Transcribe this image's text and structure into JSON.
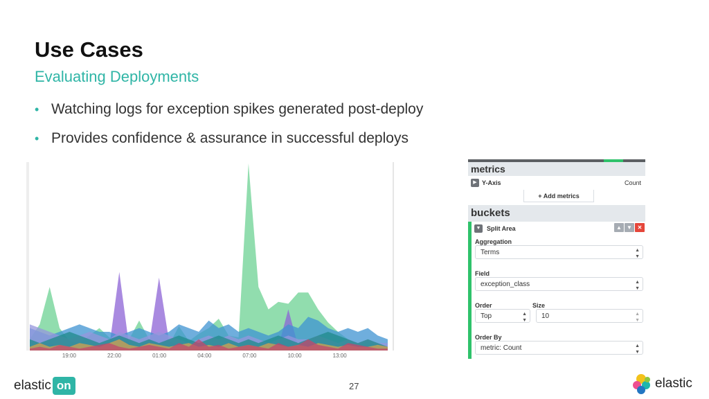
{
  "slide": {
    "title": "Use Cases",
    "subtitle": "Evaluating Deployments",
    "bullets": [
      "Watching logs for exception spikes generated post-deploy",
      "Provides confidence & assurance in successful deploys"
    ],
    "bullet_color": "#2fb5a6",
    "page_number": "27"
  },
  "chart_data": {
    "type": "area",
    "title": "",
    "xlabel": "",
    "ylabel": "",
    "stacked": false,
    "grid": false,
    "legend": "none",
    "x": [
      "19:00",
      "22:00",
      "01:00",
      "04:00",
      "07:00",
      "10:00",
      "13:00"
    ],
    "ylim": [
      0,
      100
    ],
    "series": [
      {
        "color": "#76d49a",
        "values": [
          6,
          14,
          34,
          12,
          5,
          4,
          8,
          12,
          7,
          4,
          6,
          16,
          6,
          5,
          3,
          13,
          5,
          9,
          12,
          17,
          8,
          7,
          100,
          34,
          22,
          26,
          25,
          31,
          31,
          22,
          15,
          10,
          6,
          3,
          5,
          3,
          2
        ]
      },
      {
        "color": "#8c63d6",
        "values": [
          2,
          3,
          4,
          2,
          2,
          3,
          3,
          2,
          2,
          42,
          2,
          2,
          3,
          39,
          5,
          3,
          2,
          3,
          2,
          3,
          2,
          2,
          2,
          2,
          4,
          2,
          22,
          2,
          3,
          3,
          2,
          2,
          2,
          2,
          2,
          2,
          2
        ]
      },
      {
        "color": "#3f93d1",
        "values": [
          12,
          10,
          8,
          10,
          12,
          14,
          12,
          10,
          10,
          8,
          10,
          12,
          10,
          8,
          10,
          14,
          12,
          10,
          16,
          12,
          14,
          10,
          12,
          10,
          8,
          10,
          14,
          12,
          18,
          16,
          12,
          10,
          12,
          10,
          12,
          8,
          6
        ]
      },
      {
        "color": "#9595dc",
        "values": [
          14,
          12,
          10,
          8,
          6,
          8,
          10,
          8,
          6,
          10,
          8,
          6,
          8,
          10,
          8,
          6,
          4,
          6,
          8,
          6,
          8,
          6,
          8,
          6,
          4,
          6,
          8,
          6,
          6,
          8,
          6,
          4,
          6,
          4,
          6,
          4,
          4
        ]
      },
      {
        "color": "#1f8a8a",
        "values": [
          6,
          4,
          6,
          8,
          10,
          8,
          6,
          4,
          6,
          8,
          6,
          4,
          6,
          4,
          6,
          8,
          6,
          4,
          6,
          8,
          6,
          4,
          6,
          4,
          6,
          8,
          6,
          4,
          6,
          8,
          10,
          8,
          6,
          4,
          6,
          4,
          2
        ]
      },
      {
        "color": "#d4a24e",
        "values": [
          2,
          4,
          2,
          3,
          2,
          4,
          3,
          2,
          4,
          6,
          3,
          2,
          4,
          3,
          2,
          3,
          4,
          2,
          3,
          2,
          4,
          2,
          3,
          2,
          4,
          3,
          2,
          3,
          2,
          4,
          3,
          2,
          3,
          2,
          2,
          3,
          2
        ]
      },
      {
        "color": "#c2476e",
        "values": [
          1,
          2,
          1,
          3,
          2,
          1,
          2,
          3,
          4,
          2,
          1,
          2,
          3,
          2,
          1,
          4,
          2,
          6,
          2,
          3,
          1,
          2,
          3,
          2,
          1,
          4,
          2,
          3,
          6,
          3,
          2,
          1,
          4,
          3,
          2,
          1,
          1
        ]
      }
    ]
  },
  "kibana_panel": {
    "metrics_header": "metrics",
    "y_axis_label": "Y-Axis",
    "y_axis_value": "Count",
    "add_metrics_label": "+ Add metrics",
    "buckets_header": "buckets",
    "split_label": "Split Area",
    "aggregation_label": "Aggregation",
    "aggregation_value": "Terms",
    "field_label": "Field",
    "field_value": "exception_class",
    "order_label": "Order",
    "order_value": "Top",
    "size_label": "Size",
    "size_value": "10",
    "order_by_label": "Order By",
    "order_by_value": "metric: Count",
    "accent_color": "#2fc26b",
    "remove_color": "#e5463a"
  },
  "branding": {
    "left_word": "elastic",
    "left_badge": "on",
    "right_word": "elastic"
  }
}
